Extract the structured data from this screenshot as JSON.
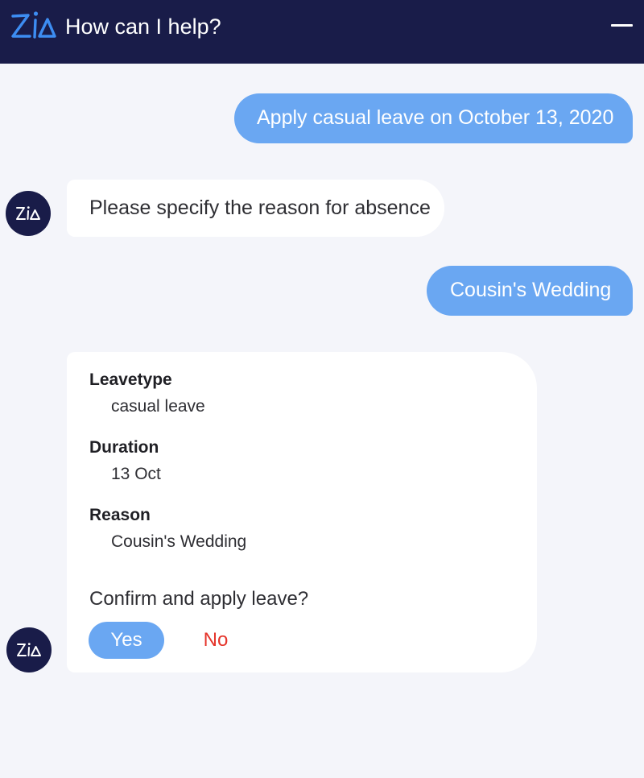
{
  "header": {
    "title": "How can I help?",
    "logo_icon": "zia-logo-icon",
    "minimize_icon": "minimize-icon"
  },
  "colors": {
    "header_bg": "#191c49",
    "user_bubble": "#6aa7f2",
    "decline": "#e5352b",
    "canvas": "#f4f5fa"
  },
  "messages": {
    "user_1": "Apply casual leave on October 13, 2020",
    "bot_1": "Please specify the reason for absence",
    "user_2": "Cousin's Wedding"
  },
  "confirmation": {
    "fields": [
      {
        "label": "Leavetype",
        "value": "casual leave"
      },
      {
        "label": "Duration",
        "value": "13 Oct"
      },
      {
        "label": "Reason",
        "value": "Cousin's Wedding"
      }
    ],
    "prompt": "Confirm and apply leave?",
    "yes_label": "Yes",
    "no_label": "No"
  }
}
